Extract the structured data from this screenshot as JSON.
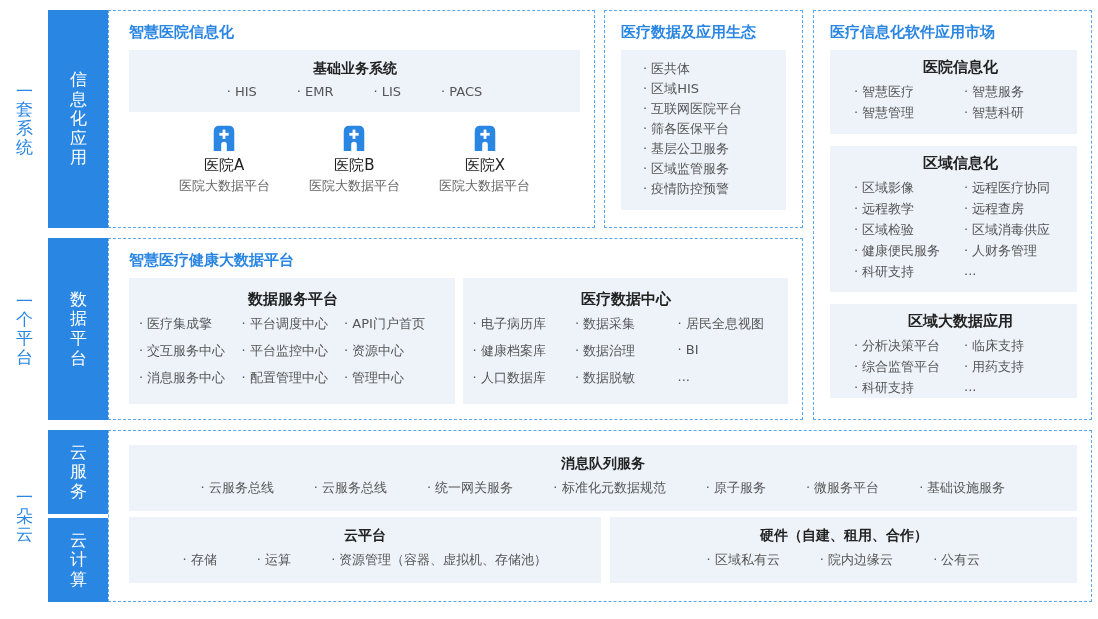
{
  "tiers": [
    {
      "label": "一套系统",
      "bars": [
        "信息化应用"
      ]
    },
    {
      "label": "一个平台",
      "bars": [
        "数据平台"
      ]
    },
    {
      "label": "一朵云",
      "bars": [
        "云服务",
        "云计算"
      ]
    }
  ],
  "hospital_it": {
    "title": "智慧医院信息化",
    "base_system": {
      "title": "基础业务系统",
      "items": [
        "· HIS",
        "· EMR",
        "· LIS",
        "· PACS"
      ]
    },
    "hospitals": [
      {
        "name": "医院A",
        "subtitle": "医院大数据平台"
      },
      {
        "name": "医院B",
        "subtitle": "医院大数据平台"
      },
      {
        "name": "医院X",
        "subtitle": "医院大数据平台"
      }
    ]
  },
  "ecosystem": {
    "title": "医疗数据及应用生态",
    "items": [
      "· 医共体",
      "· 区域HIS",
      "· 互联网医院平台",
      "· 筛各医保平台",
      "· 基层公卫服务",
      "· 区域监管服务",
      "· 疫情防控预警"
    ]
  },
  "market": {
    "title": "医疗信息化软件应用市场",
    "groups": [
      {
        "title": "医院信息化",
        "items": [
          "· 智慧医疗",
          "· 智慧服务",
          "· 智慧管理",
          "· 智慧科研"
        ]
      },
      {
        "title": "区域信息化",
        "items": [
          "· 区域影像",
          "· 远程医疗协同",
          "· 远程教学",
          "· 远程查房",
          "· 区域检验",
          "· 区域消毒供应",
          "· 健康便民服务",
          "· 人财务管理",
          "· 科研支持",
          "..."
        ]
      },
      {
        "title": "区域大数据应用",
        "items": [
          "· 分析决策平台",
          "· 临床支持",
          "· 综合监管平台",
          "· 用药支持",
          "· 科研支持",
          "..."
        ]
      }
    ]
  },
  "data_platform": {
    "title": "智慧医疗健康大数据平台",
    "panels": [
      {
        "title": "数据服务平台",
        "items": [
          "· 医疗集成擎",
          "· 平台调度中心",
          "· API门户首页",
          "· 交互服务中心",
          "· 平台监控中心",
          "· 资源中心",
          "· 消息服务中心",
          "· 配置管理中心",
          "· 管理中心"
        ]
      },
      {
        "title": "医疗数据中心",
        "items": [
          "· 电子病历库",
          "· 数据采集",
          "· 居民全息视图",
          "· 健康档案库",
          "· 数据治理",
          "· BI",
          "· 人口数据库",
          "· 数据脱敏",
          "..."
        ]
      }
    ]
  },
  "cloud": {
    "services": {
      "title": "消息队列服务",
      "items": [
        "· 云服务总线",
        "· 云服务总线",
        "· 统一网关服务",
        "· 标准化元数据规范",
        "· 原子服务",
        "· 微服务平台",
        "· 基础设施服务"
      ]
    },
    "compute": [
      {
        "title": "云平台",
        "items": [
          "· 存储",
          "· 运算",
          "· 资源管理（容器、虚拟机、存储池）"
        ]
      },
      {
        "title": "硬件（自建、租用、合作）",
        "items": [
          "· 区域私有云",
          "· 院内边缘云",
          "· 公有云"
        ]
      }
    ]
  }
}
